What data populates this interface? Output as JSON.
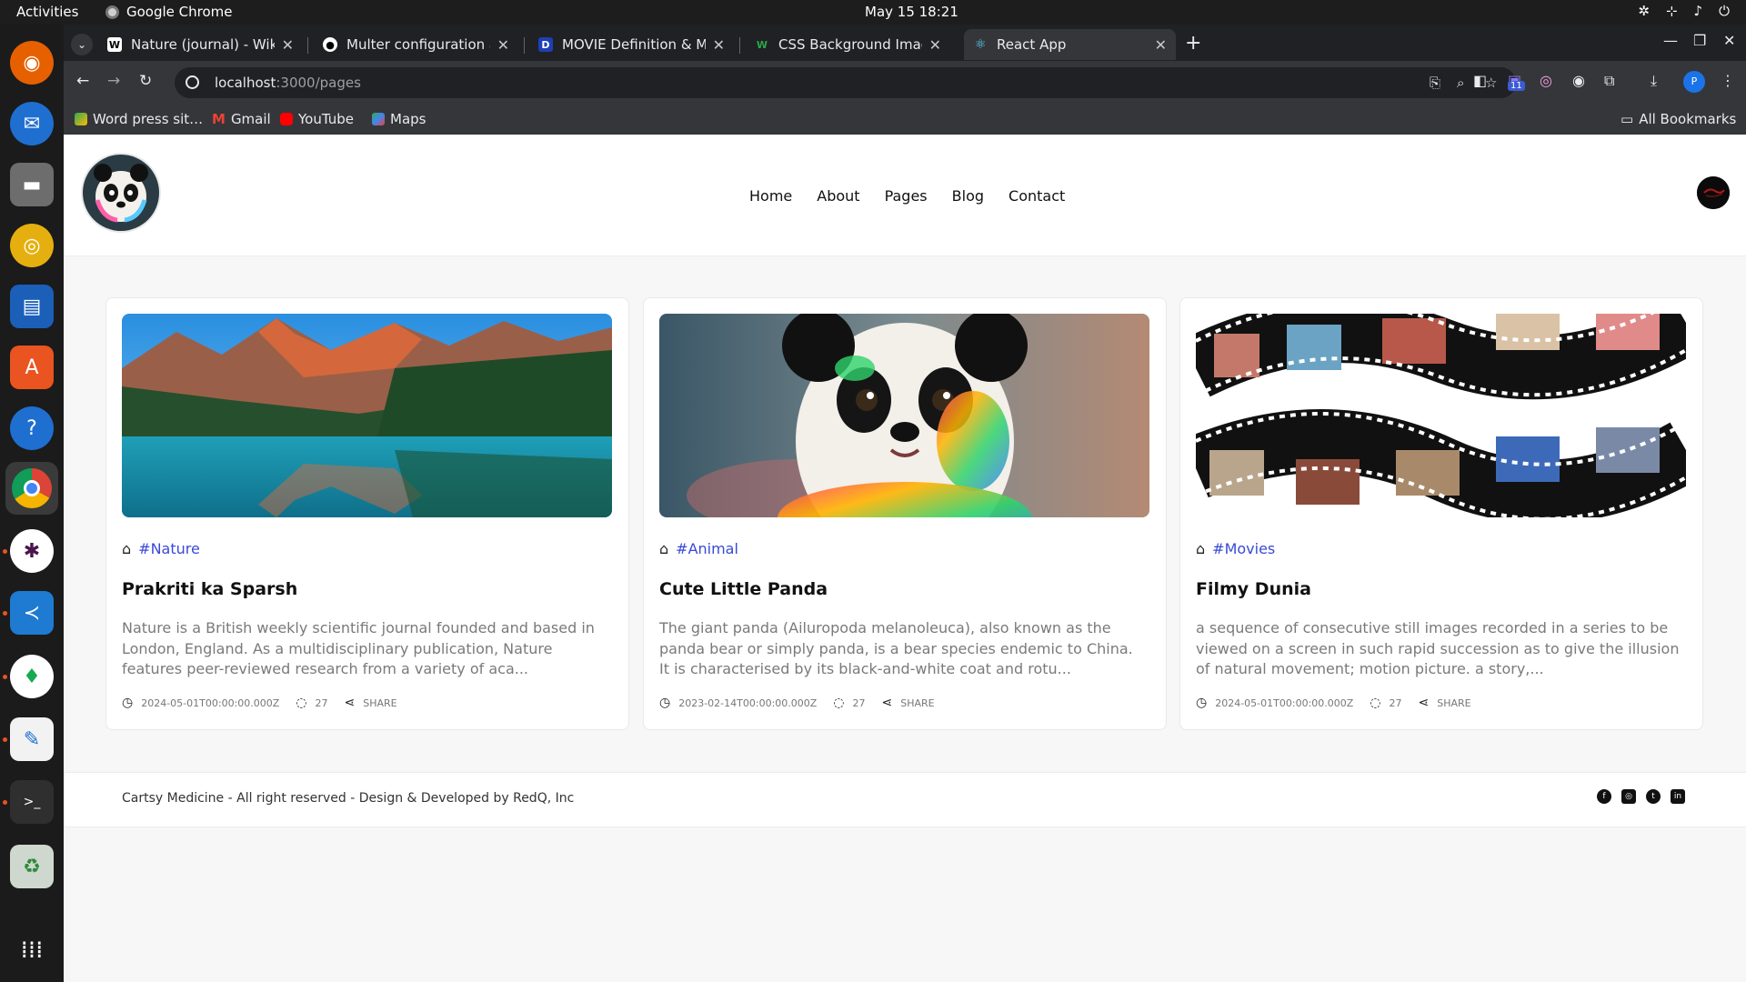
{
  "os": {
    "activities": "Activities",
    "app_name": "Google Chrome",
    "clock": "May 15  18:21"
  },
  "browser": {
    "tabs": [
      {
        "title": "Nature (journal) - Wikipe",
        "favicon": "W"
      },
      {
        "title": "Multer configuration anc",
        "favicon": "github-icon"
      },
      {
        "title": "MOVIE Definition & Mea",
        "favicon": "D"
      },
      {
        "title": "CSS Background Image F",
        "favicon": "W"
      },
      {
        "title": "React App",
        "favicon": "react-icon"
      }
    ],
    "url_host": "localhost",
    "url_path": ":3000/pages",
    "extension_badge": "11",
    "profile_initial": "P",
    "bookmarks": [
      {
        "label": "Word press sit…"
      },
      {
        "label": "Gmail"
      },
      {
        "label": "YouTube"
      },
      {
        "label": "Maps"
      }
    ],
    "all_bookmarks": "All Bookmarks"
  },
  "site": {
    "nav": [
      "Home",
      "About",
      "Pages",
      "Blog",
      "Contact"
    ],
    "cards": [
      {
        "tag": "#Nature",
        "title": "Prakriti ka Sparsh",
        "excerpt": "Nature is a British weekly scientific journal founded and based in London, England. As a multidisciplinary publication, Nature features peer-reviewed research from a variety of aca...",
        "date": "2024-05-01T00:00:00.000Z",
        "comments": "27",
        "share": "SHARE"
      },
      {
        "tag": "#Animal",
        "title": "Cute Little Panda",
        "excerpt": "The giant panda (Ailuropoda melanoleuca), also known as the panda bear or simply panda, is a bear species endemic to China. It is characterised by its black-and-white coat and rotu...",
        "date": "2023-02-14T00:00:00.000Z",
        "comments": "27",
        "share": "SHARE"
      },
      {
        "tag": "#Movies",
        "title": "Filmy Dunia",
        "excerpt": "a sequence of consecutive still images recorded in a series to be viewed on a screen in such rapid succession as to give the illusion of natural movement; motion picture. a story,...",
        "date": "2024-05-01T00:00:00.000Z",
        "comments": "27",
        "share": "SHARE"
      }
    ],
    "footer": "Cartsy Medicine - All right reserved - Design & Developed by RedQ, Inc"
  }
}
